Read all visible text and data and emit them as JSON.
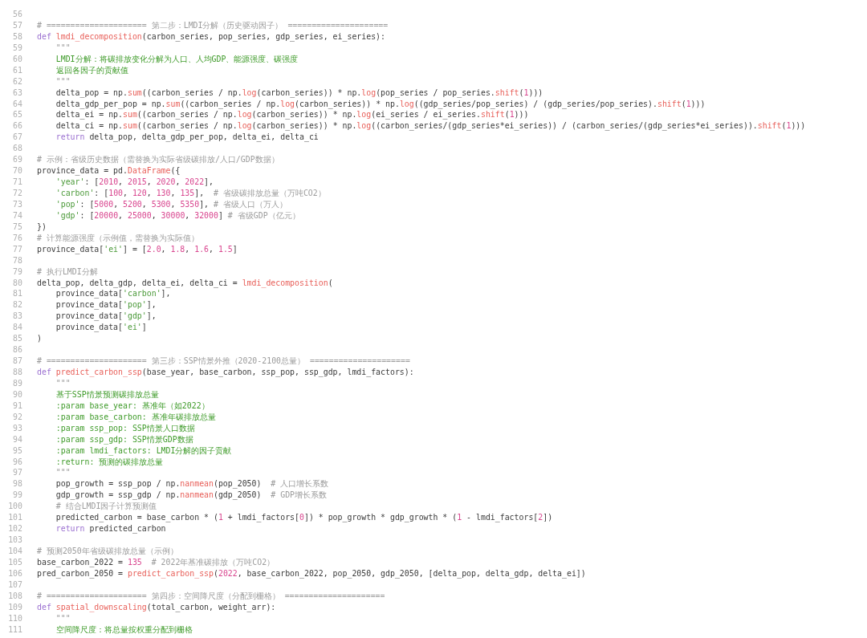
{
  "editor": {
    "lines": [
      {
        "number": "56"
      },
      {
        "number": "57",
        "tokens": [
          {
            "text": "# ===================== 第二步：LMDI分解（历史驱动因子） =====================",
            "kind": "comment"
          }
        ]
      },
      {
        "number": "58",
        "tokens": [
          {
            "text": "def ",
            "kind": "keyword"
          },
          {
            "text": "lmdi_decomposition",
            "kind": "function"
          },
          {
            "text": "(carbon_series, pop_series, gdp_series, ei_series):",
            "kind": "plain"
          }
        ]
      },
      {
        "number": "59",
        "tokens": [
          {
            "text": "    \"\"\"",
            "kind": "comment"
          }
        ]
      },
      {
        "number": "60",
        "tokens": [
          {
            "text": "    LMDI分解：将碳排放变化分解为人口、人均GDP、能源强度、碳强度",
            "kind": "docstring"
          }
        ]
      },
      {
        "number": "61",
        "tokens": [
          {
            "text": "    返回各因子的贡献值",
            "kind": "docstring"
          }
        ]
      },
      {
        "number": "62",
        "tokens": [
          {
            "text": "    \"\"\"",
            "kind": "comment"
          }
        ]
      },
      {
        "number": "63",
        "tokens": [
          {
            "text": "    delta_pop = np.",
            "kind": "plain"
          },
          {
            "text": "sum",
            "kind": "function"
          },
          {
            "text": "((carbon_series / np.",
            "kind": "plain"
          },
          {
            "text": "log",
            "kind": "function"
          },
          {
            "text": "(carbon_series)) * np.",
            "kind": "plain"
          },
          {
            "text": "log",
            "kind": "function"
          },
          {
            "text": "(pop_series / pop_series.",
            "kind": "plain"
          },
          {
            "text": "shift",
            "kind": "function"
          },
          {
            "text": "(",
            "kind": "plain"
          },
          {
            "text": "1",
            "kind": "number"
          },
          {
            "text": ")))",
            "kind": "plain"
          }
        ]
      },
      {
        "number": "64",
        "tokens": [
          {
            "text": "    delta_gdp_per_pop = np.",
            "kind": "plain"
          },
          {
            "text": "sum",
            "kind": "function"
          },
          {
            "text": "((carbon_series / np.",
            "kind": "plain"
          },
          {
            "text": "log",
            "kind": "function"
          },
          {
            "text": "(carbon_series)) * np.",
            "kind": "plain"
          },
          {
            "text": "log",
            "kind": "function"
          },
          {
            "text": "((gdp_series/pop_series) / (gdp_series/pop_series).",
            "kind": "plain"
          },
          {
            "text": "shift",
            "kind": "function"
          },
          {
            "text": "(",
            "kind": "plain"
          },
          {
            "text": "1",
            "kind": "number"
          },
          {
            "text": ")))",
            "kind": "plain"
          }
        ]
      },
      {
        "number": "65",
        "tokens": [
          {
            "text": "    delta_ei = np.",
            "kind": "plain"
          },
          {
            "text": "sum",
            "kind": "function"
          },
          {
            "text": "((carbon_series / np.",
            "kind": "plain"
          },
          {
            "text": "log",
            "kind": "function"
          },
          {
            "text": "(carbon_series)) * np.",
            "kind": "plain"
          },
          {
            "text": "log",
            "kind": "function"
          },
          {
            "text": "(ei_series / ei_series.",
            "kind": "plain"
          },
          {
            "text": "shift",
            "kind": "function"
          },
          {
            "text": "(",
            "kind": "plain"
          },
          {
            "text": "1",
            "kind": "number"
          },
          {
            "text": ")))",
            "kind": "plain"
          }
        ]
      },
      {
        "number": "66",
        "tokens": [
          {
            "text": "    delta_ci = np.",
            "kind": "plain"
          },
          {
            "text": "sum",
            "kind": "function"
          },
          {
            "text": "((carbon_series / np.",
            "kind": "plain"
          },
          {
            "text": "log",
            "kind": "function"
          },
          {
            "text": "(carbon_series)) * np.",
            "kind": "plain"
          },
          {
            "text": "log",
            "kind": "function"
          },
          {
            "text": "((carbon_series/(gdp_series*ei_series)) / (carbon_series/(gdp_series*ei_series)).",
            "kind": "plain"
          },
          {
            "text": "shift",
            "kind": "function"
          },
          {
            "text": "(",
            "kind": "plain"
          },
          {
            "text": "1",
            "kind": "number"
          },
          {
            "text": ")))",
            "kind": "plain"
          }
        ]
      },
      {
        "number": "67",
        "tokens": [
          {
            "text": "    return",
            "kind": "keyword"
          },
          {
            "text": " delta_pop, delta_gdp_per_pop, delta_ei, delta_ci",
            "kind": "plain"
          }
        ]
      },
      {
        "number": "68"
      },
      {
        "number": "69",
        "tokens": [
          {
            "text": "# 示例：省级历史数据（需替换为实际省级碳排放/人口/GDP数据）",
            "kind": "comment"
          }
        ]
      },
      {
        "number": "70",
        "tokens": [
          {
            "text": "province_data = pd.",
            "kind": "plain"
          },
          {
            "text": "DataFrame",
            "kind": "function"
          },
          {
            "text": "({",
            "kind": "plain"
          }
        ]
      },
      {
        "number": "71",
        "tokens": [
          {
            "text": "    'year'",
            "kind": "string"
          },
          {
            "text": ": [",
            "kind": "plain"
          },
          {
            "text": "2010",
            "kind": "number"
          },
          {
            "text": ", ",
            "kind": "plain"
          },
          {
            "text": "2015",
            "kind": "number"
          },
          {
            "text": ", ",
            "kind": "plain"
          },
          {
            "text": "2020",
            "kind": "number"
          },
          {
            "text": ", ",
            "kind": "plain"
          },
          {
            "text": "2022",
            "kind": "number"
          },
          {
            "text": "],",
            "kind": "plain"
          }
        ]
      },
      {
        "number": "72",
        "tokens": [
          {
            "text": "    'carbon'",
            "kind": "string"
          },
          {
            "text": ": [",
            "kind": "plain"
          },
          {
            "text": "100",
            "kind": "number"
          },
          {
            "text": ", ",
            "kind": "plain"
          },
          {
            "text": "120",
            "kind": "number"
          },
          {
            "text": ", ",
            "kind": "plain"
          },
          {
            "text": "130",
            "kind": "number"
          },
          {
            "text": ", ",
            "kind": "plain"
          },
          {
            "text": "135",
            "kind": "number"
          },
          {
            "text": "],  ",
            "kind": "plain"
          },
          {
            "text": "# 省级碳排放总量（万吨CO2）",
            "kind": "comment"
          }
        ]
      },
      {
        "number": "73",
        "tokens": [
          {
            "text": "    'pop'",
            "kind": "string"
          },
          {
            "text": ": [",
            "kind": "plain"
          },
          {
            "text": "5000",
            "kind": "number"
          },
          {
            "text": ", ",
            "kind": "plain"
          },
          {
            "text": "5200",
            "kind": "number"
          },
          {
            "text": ", ",
            "kind": "plain"
          },
          {
            "text": "5300",
            "kind": "number"
          },
          {
            "text": ", ",
            "kind": "plain"
          },
          {
            "text": "5350",
            "kind": "number"
          },
          {
            "text": "], ",
            "kind": "plain"
          },
          {
            "text": "# 省级人口（万人）",
            "kind": "comment"
          }
        ]
      },
      {
        "number": "74",
        "tokens": [
          {
            "text": "    'gdp'",
            "kind": "string"
          },
          {
            "text": ": [",
            "kind": "plain"
          },
          {
            "text": "20000",
            "kind": "number"
          },
          {
            "text": ", ",
            "kind": "plain"
          },
          {
            "text": "25000",
            "kind": "number"
          },
          {
            "text": ", ",
            "kind": "plain"
          },
          {
            "text": "30000",
            "kind": "number"
          },
          {
            "text": ", ",
            "kind": "plain"
          },
          {
            "text": "32000",
            "kind": "number"
          },
          {
            "text": "] ",
            "kind": "plain"
          },
          {
            "text": "# 省级GDP（亿元）",
            "kind": "comment"
          }
        ]
      },
      {
        "number": "75",
        "tokens": [
          {
            "text": "})",
            "kind": "plain"
          }
        ]
      },
      {
        "number": "76",
        "tokens": [
          {
            "text": "# 计算能源强度（示例值，需替换为实际值）",
            "kind": "comment"
          }
        ]
      },
      {
        "number": "77",
        "tokens": [
          {
            "text": "province_data[",
            "kind": "plain"
          },
          {
            "text": "'ei'",
            "kind": "string"
          },
          {
            "text": "] = [",
            "kind": "plain"
          },
          {
            "text": "2.0",
            "kind": "number"
          },
          {
            "text": ", ",
            "kind": "plain"
          },
          {
            "text": "1.8",
            "kind": "number"
          },
          {
            "text": ", ",
            "kind": "plain"
          },
          {
            "text": "1.6",
            "kind": "number"
          },
          {
            "text": ", ",
            "kind": "plain"
          },
          {
            "text": "1.5",
            "kind": "number"
          },
          {
            "text": "]",
            "kind": "plain"
          }
        ]
      },
      {
        "number": "78"
      },
      {
        "number": "79",
        "tokens": [
          {
            "text": "# 执行LMDI分解",
            "kind": "comment"
          }
        ]
      },
      {
        "number": "80",
        "tokens": [
          {
            "text": "delta_pop, delta_gdp, delta_ei, delta_ci = ",
            "kind": "plain"
          },
          {
            "text": "lmdi_decomposition",
            "kind": "function"
          },
          {
            "text": "(",
            "kind": "plain"
          }
        ]
      },
      {
        "number": "81",
        "tokens": [
          {
            "text": "    province_data[",
            "kind": "plain"
          },
          {
            "text": "'carbon'",
            "kind": "string"
          },
          {
            "text": "],",
            "kind": "plain"
          }
        ]
      },
      {
        "number": "82",
        "tokens": [
          {
            "text": "    province_data[",
            "kind": "plain"
          },
          {
            "text": "'pop'",
            "kind": "string"
          },
          {
            "text": "],",
            "kind": "plain"
          }
        ]
      },
      {
        "number": "83",
        "tokens": [
          {
            "text": "    province_data[",
            "kind": "plain"
          },
          {
            "text": "'gdp'",
            "kind": "string"
          },
          {
            "text": "],",
            "kind": "plain"
          }
        ]
      },
      {
        "number": "84",
        "tokens": [
          {
            "text": "    province_data[",
            "kind": "plain"
          },
          {
            "text": "'ei'",
            "kind": "string"
          },
          {
            "text": "]",
            "kind": "plain"
          }
        ]
      },
      {
        "number": "85",
        "tokens": [
          {
            "text": ")",
            "kind": "plain"
          }
        ]
      },
      {
        "number": "86"
      },
      {
        "number": "87",
        "tokens": [
          {
            "text": "# ===================== 第三步：SSP情景外推（2020-2100总量） =====================",
            "kind": "comment"
          }
        ]
      },
      {
        "number": "88",
        "tokens": [
          {
            "text": "def ",
            "kind": "keyword"
          },
          {
            "text": "predict_carbon_ssp",
            "kind": "function"
          },
          {
            "text": "(base_year, base_carbon, ssp_pop, ssp_gdp, lmdi_factors):",
            "kind": "plain"
          }
        ]
      },
      {
        "number": "89",
        "tokens": [
          {
            "text": "    \"\"\"",
            "kind": "comment"
          }
        ]
      },
      {
        "number": "90",
        "tokens": [
          {
            "text": "    基于SSP情景预测碳排放总量",
            "kind": "docstring"
          }
        ]
      },
      {
        "number": "91",
        "tokens": [
          {
            "text": "    :param base_year: 基准年（如2022）",
            "kind": "docstring"
          }
        ]
      },
      {
        "number": "92",
        "tokens": [
          {
            "text": "    :param base_carbon: 基准年碳排放总量",
            "kind": "docstring"
          }
        ]
      },
      {
        "number": "93",
        "tokens": [
          {
            "text": "    :param ssp_pop: SSP情景人口数据",
            "kind": "docstring"
          }
        ]
      },
      {
        "number": "94",
        "tokens": [
          {
            "text": "    :param ssp_gdp: SSP情景GDP数据",
            "kind": "docstring"
          }
        ]
      },
      {
        "number": "95",
        "tokens": [
          {
            "text": "    :param lmdi_factors: LMDI分解的因子贡献",
            "kind": "docstring"
          }
        ]
      },
      {
        "number": "96",
        "tokens": [
          {
            "text": "    :return: 预测的碳排放总量",
            "kind": "docstring"
          }
        ]
      },
      {
        "number": "97",
        "tokens": [
          {
            "text": "    \"\"\"",
            "kind": "comment"
          }
        ]
      },
      {
        "number": "98",
        "tokens": [
          {
            "text": "    pop_growth = ssp_pop / np.",
            "kind": "plain"
          },
          {
            "text": "nanmean",
            "kind": "function"
          },
          {
            "text": "(pop_2050)  ",
            "kind": "plain"
          },
          {
            "text": "# 人口增长系数",
            "kind": "comment"
          }
        ]
      },
      {
        "number": "99",
        "tokens": [
          {
            "text": "    gdp_growth = ssp_gdp / np.",
            "kind": "plain"
          },
          {
            "text": "nanmean",
            "kind": "function"
          },
          {
            "text": "(gdp_2050)  ",
            "kind": "plain"
          },
          {
            "text": "# GDP增长系数",
            "kind": "comment"
          }
        ]
      },
      {
        "number": "100",
        "tokens": [
          {
            "text": "    # 结合LMDI因子计算预测值",
            "kind": "comment"
          }
        ]
      },
      {
        "number": "101",
        "tokens": [
          {
            "text": "    predicted_carbon = base_carbon * (",
            "kind": "plain"
          },
          {
            "text": "1",
            "kind": "number"
          },
          {
            "text": " + lmdi_factors[",
            "kind": "plain"
          },
          {
            "text": "0",
            "kind": "number"
          },
          {
            "text": "]) * pop_growth * gdp_growth * (",
            "kind": "plain"
          },
          {
            "text": "1",
            "kind": "number"
          },
          {
            "text": " - lmdi_factors[",
            "kind": "plain"
          },
          {
            "text": "2",
            "kind": "number"
          },
          {
            "text": "])",
            "kind": "plain"
          }
        ]
      },
      {
        "number": "102",
        "tokens": [
          {
            "text": "    return",
            "kind": "keyword"
          },
          {
            "text": " predicted_carbon",
            "kind": "plain"
          }
        ]
      },
      {
        "number": "103"
      },
      {
        "number": "104",
        "tokens": [
          {
            "text": "# 预测2050年省级碳排放总量（示例）",
            "kind": "comment"
          }
        ]
      },
      {
        "number": "105",
        "tokens": [
          {
            "text": "base_carbon_2022 = ",
            "kind": "plain"
          },
          {
            "text": "135",
            "kind": "number"
          },
          {
            "text": "  # 2022年基准碳排放（万吨CO2）",
            "kind": "comment"
          }
        ]
      },
      {
        "number": "106",
        "tokens": [
          {
            "text": "pred_carbon_2050 = ",
            "kind": "plain"
          },
          {
            "text": "predict_carbon_ssp",
            "kind": "function"
          },
          {
            "text": "(",
            "kind": "plain"
          },
          {
            "text": "2022",
            "kind": "number"
          },
          {
            "text": ", base_carbon_2022, pop_2050, gdp_2050, [delta_pop, delta_gdp, delta_ei])",
            "kind": "plain"
          }
        ]
      },
      {
        "number": "107"
      },
      {
        "number": "108",
        "tokens": [
          {
            "text": "# ===================== 第四步：空间降尺度（分配到栅格） =====================",
            "kind": "comment"
          }
        ]
      },
      {
        "number": "109",
        "tokens": [
          {
            "text": "def ",
            "kind": "keyword"
          },
          {
            "text": "spatial_downscaling",
            "kind": "function"
          },
          {
            "text": "(total_carbon, weight_arr):",
            "kind": "plain"
          }
        ]
      },
      {
        "number": "110",
        "tokens": [
          {
            "text": "    \"\"\"",
            "kind": "comment"
          }
        ]
      },
      {
        "number": "111",
        "tokens": [
          {
            "text": "    空间降尺度：将总量按权重分配到栅格",
            "kind": "docstring"
          }
        ]
      }
    ]
  }
}
